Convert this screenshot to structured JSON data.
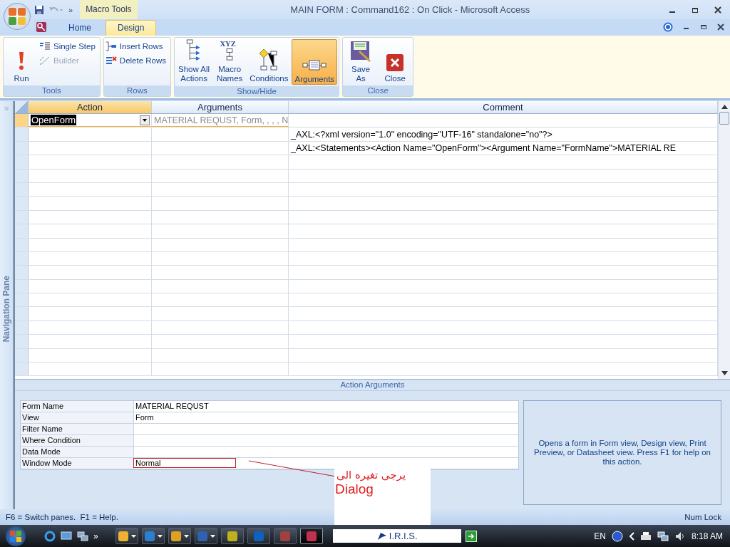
{
  "window": {
    "title": "MAIN FORM : Command162 : On Click - Microsoft Access",
    "contextual_tab": "Macro Tools"
  },
  "tabs": [
    {
      "label": "Home",
      "selected": false
    },
    {
      "label": "Design",
      "selected": true
    }
  ],
  "ribbon": {
    "groups": [
      {
        "label": "Tools",
        "buttons": [
          {
            "label": "Run",
            "kind": "large",
            "disabled": false
          },
          {
            "label": "Single Step",
            "kind": "small",
            "disabled": false
          },
          {
            "label": "Builder",
            "kind": "small",
            "disabled": true
          }
        ]
      },
      {
        "label": "Rows",
        "buttons": [
          {
            "label": "Insert Rows",
            "kind": "small",
            "disabled": false
          },
          {
            "label": "Delete Rows",
            "kind": "small",
            "disabled": false
          }
        ]
      },
      {
        "label": "Show/Hide",
        "buttons": [
          {
            "label": "Show All\nActions",
            "kind": "large",
            "disabled": false,
            "on": false
          },
          {
            "label": "Macro\nNames",
            "kind": "large",
            "disabled": false,
            "on": false,
            "icon_text": "XYZ"
          },
          {
            "label": "Conditions",
            "kind": "large",
            "disabled": false,
            "on": false
          },
          {
            "label": "Arguments",
            "kind": "large",
            "disabled": false,
            "on": true
          }
        ]
      },
      {
        "label": "Close",
        "buttons": [
          {
            "label": "Save\nAs",
            "kind": "large",
            "disabled": false
          },
          {
            "label": "Close",
            "kind": "large",
            "disabled": false
          }
        ]
      }
    ]
  },
  "navigation_pane": {
    "label": "Navigation Pane",
    "expand": "»"
  },
  "grid": {
    "columns": [
      "Action",
      "Arguments",
      "Comment"
    ],
    "rows": [
      {
        "action": "OpenForm",
        "arguments": "MATERIAL REQUST, Form, , , , N",
        "selected": true
      },
      {
        "comment": "_AXL:<?xml version=\"1.0\" encoding=\"UTF-16\" standalone=\"no\"?>",
        "selected": false
      },
      {
        "comment": "_AXL:<Statements><Action Name=\"OpenForm\"><Argument Name=\"FormName\">MATERIAL RE",
        "selected": false
      }
    ]
  },
  "action_arguments": {
    "title": "Action Arguments",
    "fields": [
      {
        "label": "Form Name",
        "value": "MATERIAL REQUST",
        "highlighted": false
      },
      {
        "label": "View",
        "value": "Form",
        "highlighted": false
      },
      {
        "label": "Filter Name",
        "highlighted": false
      },
      {
        "label": "Where Condition",
        "highlighted": false
      },
      {
        "label": "Data Mode",
        "highlighted": false
      },
      {
        "label": "Window Mode",
        "value": "Normal",
        "highlighted": true
      }
    ],
    "help": "Opens a form in Form view, Design view, Print Preview, or Datasheet view. Press F1 for help on this action."
  },
  "annotation": {
    "lines": [
      "يرجى تغيره الى",
      "Dialog"
    ]
  },
  "status_bar": {
    "left": "F6 = Switch panes.  F1 = Help.",
    "right": "Num Lock"
  },
  "taskbar": {
    "quick_launch_more": "»",
    "tasks": [
      {
        "grouped": true,
        "active": false
      },
      {
        "grouped": true,
        "active": false
      },
      {
        "grouped": true,
        "active": false
      },
      {
        "grouped": true,
        "active": false
      },
      {
        "grouped": false,
        "active": false
      },
      {
        "grouped": false,
        "active": false
      },
      {
        "grouped": false,
        "active": false
      },
      {
        "grouped": false,
        "active": true
      }
    ],
    "address_box": "I.R.I.S.",
    "language": "EN",
    "time": "8:18 AM"
  }
}
